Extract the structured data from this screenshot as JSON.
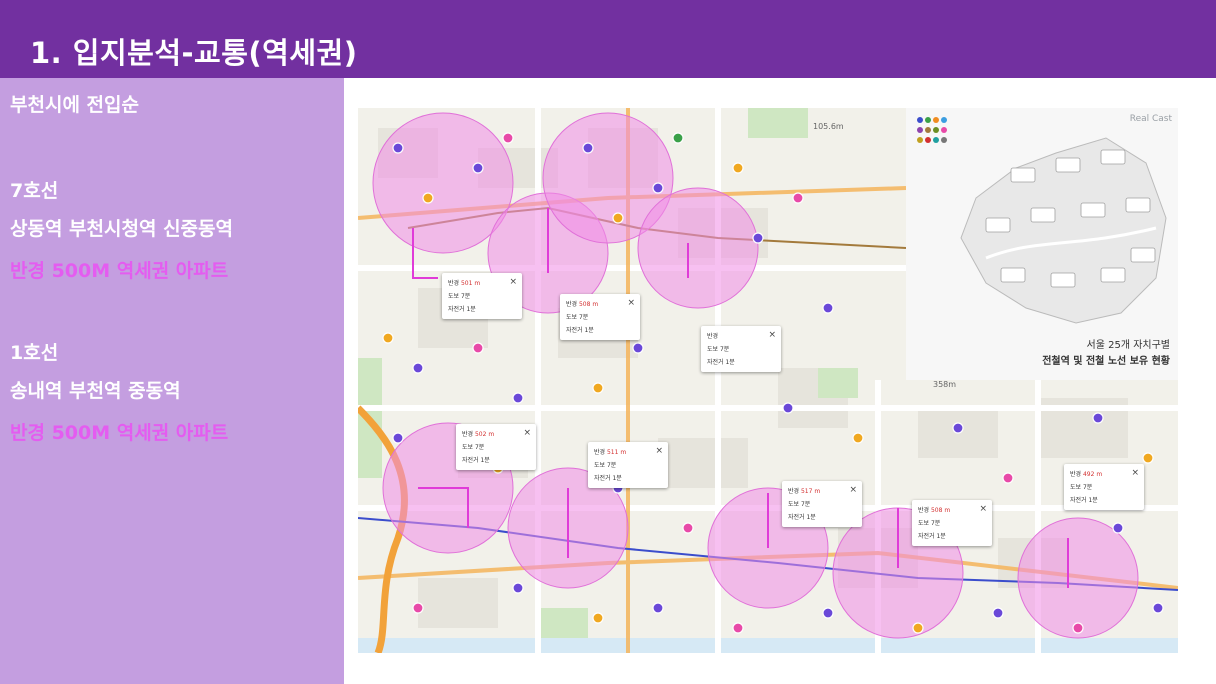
{
  "slide": {
    "title": "1. 입지분석-교통(역세권)",
    "colors": {
      "header": "#7230a0",
      "panel": "#c49ee0",
      "accent": "#e45cf0",
      "circle": "#f08ce6"
    }
  },
  "left_panel": {
    "heading": "부천시에 전입순",
    "line7_name": "7호선",
    "line7_stations": "상동역 부천시청역 신중동역",
    "line7_radius": "반경 500M 역세권 아파트",
    "line1_name": "1호선",
    "line1_stations": "송내역 부천역 중동역",
    "line1_radius": "반경 500M 역세권 아파트"
  },
  "map": {
    "inset": {
      "brand": "Real Cast",
      "caption1": "서울 25개 자치구별",
      "caption2": "전철역 및 전철 노선 보유 현황"
    },
    "distance_labels": [
      "105.6m",
      "358m"
    ],
    "popups": [
      {
        "label_radius": "반경",
        "radius": "501 m",
        "label_walk": "도보",
        "walk": "7분",
        "label_bike": "자전거",
        "bike": "1분"
      },
      {
        "label_radius": "반경",
        "radius": "508 m",
        "label_walk": "도보",
        "walk": "7분",
        "label_bike": "자전거",
        "bike": "1분"
      },
      {
        "label_radius": "반경",
        "radius": "",
        "label_walk": "도보",
        "walk": "7분",
        "label_bike": "자전거",
        "bike": "1분"
      },
      {
        "label_radius": "반경",
        "radius": "502 m",
        "label_walk": "도보",
        "walk": "7분",
        "label_bike": "자전거",
        "bike": "1분"
      },
      {
        "label_radius": "반경",
        "radius": "511 m",
        "label_walk": "도보",
        "walk": "7분",
        "label_bike": "자전거",
        "bike": "1분"
      },
      {
        "label_radius": "반경",
        "radius": "517 m",
        "label_walk": "도보",
        "walk": "7분",
        "label_bike": "자전거",
        "bike": "1분"
      },
      {
        "label_radius": "반경",
        "radius": "508 m",
        "label_walk": "도보",
        "walk": "7분",
        "label_bike": "자전거",
        "bike": "1분"
      },
      {
        "label_radius": "반경",
        "radius": "492 m",
        "label_walk": "도보",
        "walk": "7분",
        "label_bike": "자전거",
        "bike": "1분"
      }
    ]
  }
}
